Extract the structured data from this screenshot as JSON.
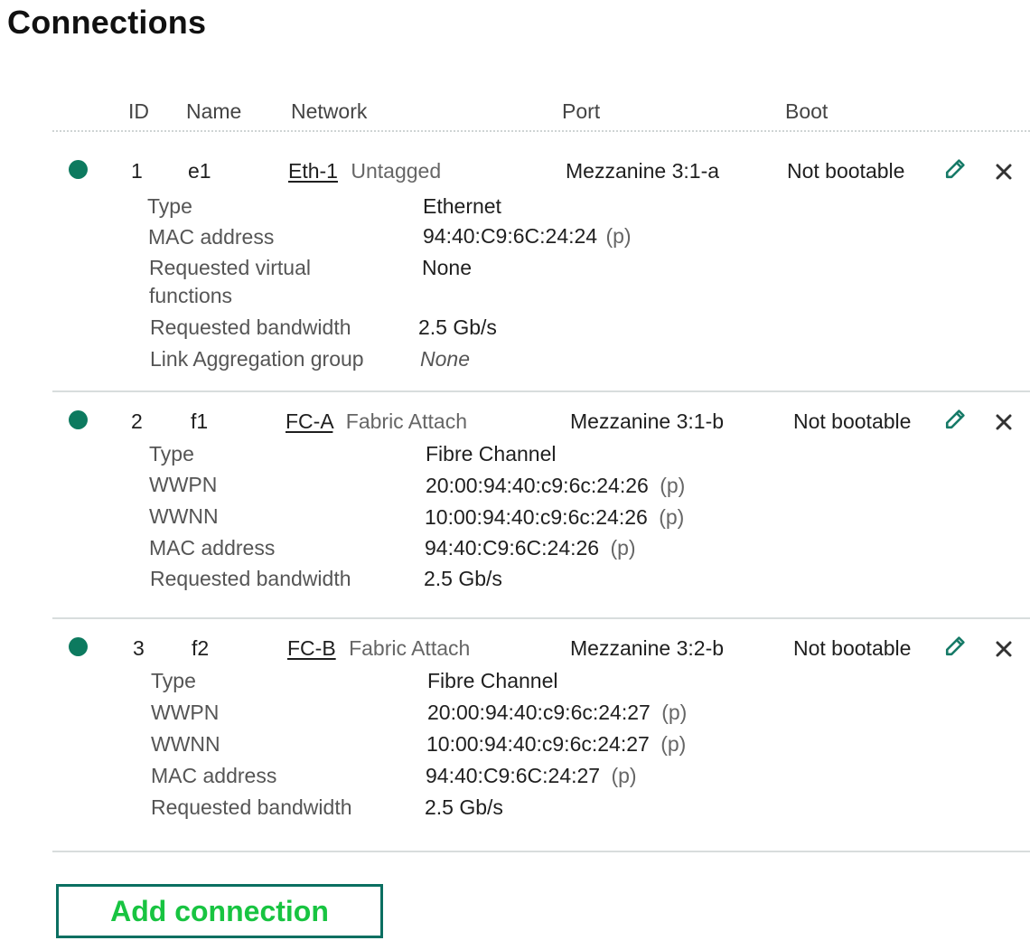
{
  "page": {
    "title": "Connections"
  },
  "table": {
    "headers": {
      "id": "ID",
      "name": "Name",
      "network": "Network",
      "port": "Port",
      "boot": "Boot"
    }
  },
  "connections": [
    {
      "id": "1",
      "name": "e1",
      "network_link": "Eth-1",
      "network_mode": "Untagged",
      "port": "Mezzanine 3:1-a",
      "boot": "Not bootable",
      "details": [
        {
          "label": "Type",
          "value": "Ethernet",
          "suffix": ""
        },
        {
          "label": "MAC address",
          "value": "94:40:C9:6C:24:24",
          "suffix": "(p)"
        },
        {
          "label": "Requested virtual",
          "label2": "functions",
          "value": "None",
          "suffix": ""
        },
        {
          "label": "Requested bandwidth",
          "value": "2.5 Gb/s",
          "suffix": ""
        },
        {
          "label": "Link Aggregation group",
          "value": "None",
          "suffix": ""
        }
      ]
    },
    {
      "id": "2",
      "name": "f1",
      "network_link": "FC-A",
      "network_mode": "Fabric Attach",
      "port": "Mezzanine 3:1-b",
      "boot": "Not bootable",
      "details": [
        {
          "label": "Type",
          "value": "Fibre Channel",
          "suffix": ""
        },
        {
          "label": "WWPN",
          "value": "20:00:94:40:c9:6c:24:26",
          "suffix": "(p)"
        },
        {
          "label": "WWNN",
          "value": "10:00:94:40:c9:6c:24:26",
          "suffix": "(p)"
        },
        {
          "label": "MAC address",
          "value": "94:40:C9:6C:24:26",
          "suffix": "(p)"
        },
        {
          "label": "Requested bandwidth",
          "value": "2.5 Gb/s",
          "suffix": ""
        }
      ]
    },
    {
      "id": "3",
      "name": "f2",
      "network_link": "FC-B",
      "network_mode": "Fabric Attach",
      "port": "Mezzanine 3:2-b",
      "boot": "Not bootable",
      "details": [
        {
          "label": "Type",
          "value": "Fibre Channel",
          "suffix": ""
        },
        {
          "label": "WWPN",
          "value": "20:00:94:40:c9:6c:24:27",
          "suffix": "(p)"
        },
        {
          "label": "WWNN",
          "value": "10:00:94:40:c9:6c:24:27",
          "suffix": "(p)"
        },
        {
          "label": "MAC address",
          "value": "94:40:C9:6C:24:27",
          "suffix": "(p)"
        },
        {
          "label": "Requested bandwidth",
          "value": "2.5 Gb/s",
          "suffix": ""
        }
      ]
    }
  ],
  "icons": {
    "status": "status-dot-icon",
    "edit": "pencil-icon",
    "remove": "close-icon"
  },
  "actions": {
    "add_connection_label": "Add connection"
  },
  "colors": {
    "status": "#0d7a5f",
    "edit_icon": "#167a67",
    "add_border": "#0b6f61",
    "add_text": "#18c441"
  }
}
